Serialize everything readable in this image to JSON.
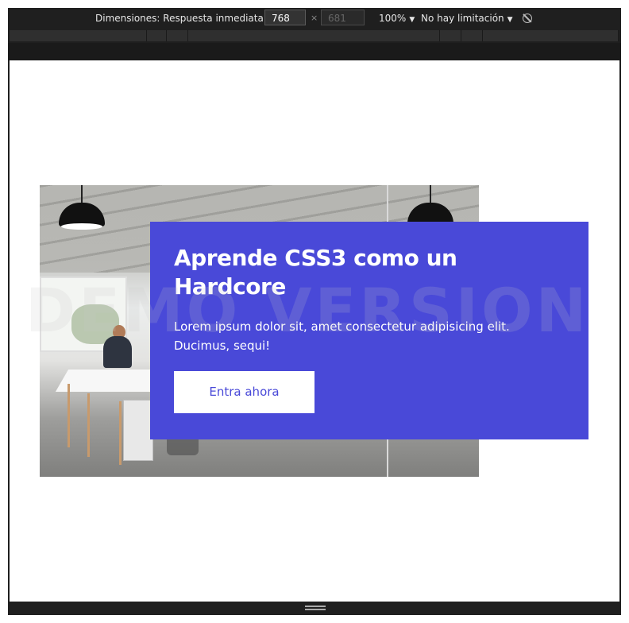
{
  "toolbar": {
    "dimensions_label": "Dimensiones: Respuesta inmediata",
    "width_value": "768",
    "height_value": "681",
    "times_symbol": "×",
    "zoom": "100%",
    "throttling": "No hay limitación",
    "dropdown_glyph": "▼",
    "rotate_icon": "rotate-icon"
  },
  "hero": {
    "title": "Aprende CSS3 como un Hardcore",
    "text": "Lorem ipsum dolor sit, amet consectetur adipisicing elit. Ducimus, sequi!",
    "button_label": "Entra ahora"
  },
  "watermark": "DEMO VERSION",
  "colors": {
    "card": "#4949d8",
    "toolbar": "#1f1f1f",
    "button_text": "#4949d8"
  }
}
